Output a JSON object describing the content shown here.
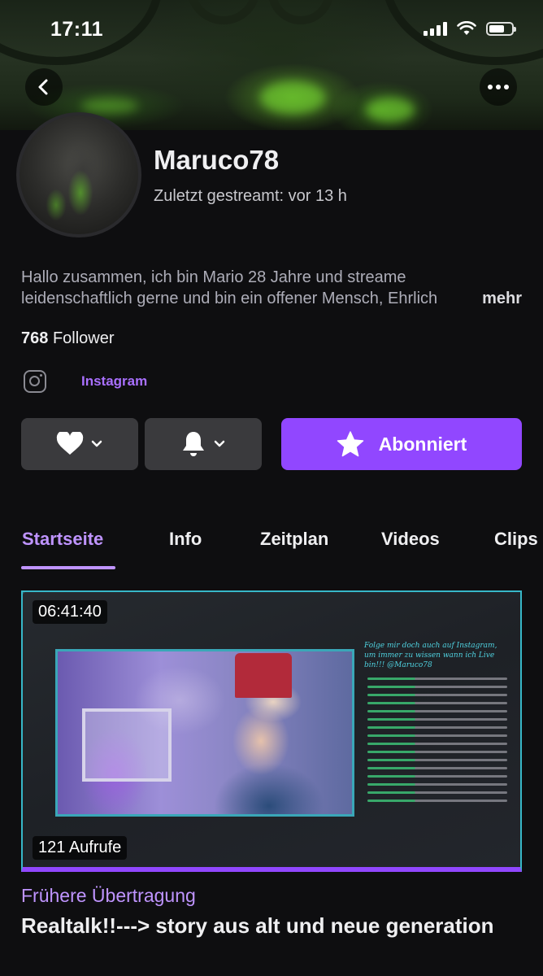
{
  "status_bar": {
    "time": "17:11"
  },
  "profile": {
    "name": "Maruco78",
    "last_stream": "Zuletzt gestreamt: vor 13 h",
    "bio_line1": "Hallo zusammen, ich bin Mario 28 Jahre und streame",
    "bio_line2": "leidenschaftlich gerne und bin ein offener Mensch, Ehrlich",
    "bio_more": "mehr",
    "followers_count": "768",
    "followers_label": "Follower",
    "social_label": "Instagram"
  },
  "actions": {
    "subscribe_label": "Abonniert"
  },
  "tabs": [
    {
      "label": "Startseite",
      "active": true
    },
    {
      "label": "Info",
      "active": false
    },
    {
      "label": "Zeitplan",
      "active": false
    },
    {
      "label": "Videos",
      "active": false
    },
    {
      "label": "Clips",
      "active": false
    }
  ],
  "video": {
    "duration": "06:41:40",
    "views": "121 Aufrufe",
    "category": "Frühere Übertragung",
    "title": "Realtalk!!---> story aus alt und neue generation",
    "overlay_text": "Folge mir doch auch auf Instagram, um immer zu wissen wann ich Live bin!!! @Maruco78"
  },
  "colors": {
    "accent": "#9147ff",
    "accent_text": "#bf94ff",
    "background": "#0e0e10",
    "button_gray": "#3a3a3d"
  }
}
